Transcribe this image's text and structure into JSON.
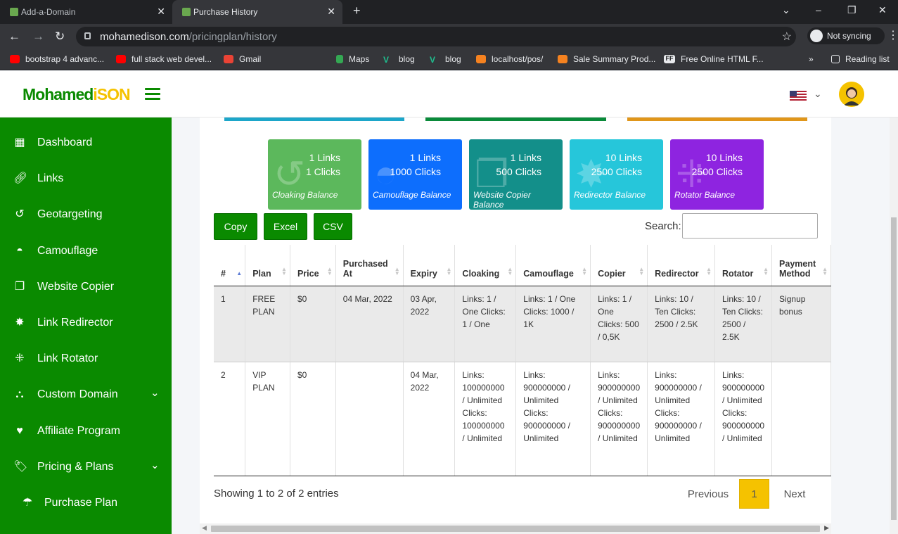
{
  "browser": {
    "tabs": [
      {
        "title": "Add-a-Domain",
        "close": "✕"
      },
      {
        "title": "Purchase History",
        "close": "✕"
      }
    ],
    "new_tab": "+",
    "url_host": "mohamedison.com",
    "url_path": "/pricingplan/history",
    "profile_label": "Not syncing",
    "bookmarks": [
      "bootstrap 4 advanc...",
      "full stack web devel...",
      "Gmail",
      "Maps",
      "blog",
      "blog",
      "localhost/pos/",
      "Sale Summary Prod...",
      "Free Online HTML F..."
    ],
    "bookmarks_more": "»",
    "reading_list": "Reading list"
  },
  "header": {
    "logo_part1": "Mohamed",
    "logo_part2": "iSON",
    "language_caret": "⌄"
  },
  "sidebar": {
    "items": [
      {
        "label": "Dashboard",
        "icon": "dashboard-icon"
      },
      {
        "label": "Links",
        "icon": "link-icon"
      },
      {
        "label": "Geotargeting",
        "icon": "history-icon"
      },
      {
        "label": "Camouflage",
        "icon": "hat-icon"
      },
      {
        "label": "Website Copier",
        "icon": "copy-icon"
      },
      {
        "label": "Link Redirector",
        "icon": "star-icon"
      },
      {
        "label": "Link Rotator",
        "icon": "rotator-icon"
      },
      {
        "label": "Custom Domain",
        "icon": "sitemap-icon",
        "caret": "⌄"
      },
      {
        "label": "Affiliate Program",
        "icon": "heart-icon"
      },
      {
        "label": "Pricing & Plans",
        "icon": "tags-icon",
        "caret": "⌄"
      },
      {
        "label": "Purchase Plan",
        "icon": "umbrella-icon"
      }
    ]
  },
  "tiles": [
    {
      "links": "1 Links",
      "clicks": "1 Clicks",
      "label": "Cloaking Balance",
      "color": "#5cb85c"
    },
    {
      "links": "1 Links",
      "clicks": "1000 Clicks",
      "label": "Camouflage Balance",
      "color": "#0d6efd"
    },
    {
      "links": "1 Links",
      "clicks": "500 Clicks",
      "label": "Website Copier Balance",
      "color": "#138f8a"
    },
    {
      "links": "10 Links",
      "clicks": "2500 Clicks",
      "label": "Redirector Balance",
      "color": "#26c6da"
    },
    {
      "links": "10 Links",
      "clicks": "2500 Clicks",
      "label": "Rotator Balance",
      "color": "#8e24e0"
    }
  ],
  "toolbar": {
    "copy": "Copy",
    "excel": "Excel",
    "csv": "CSV",
    "search_label": "Search:",
    "search_value": ""
  },
  "table": {
    "headers": [
      "#",
      "Plan",
      "Price",
      "Purchased At",
      "Expiry",
      "Cloaking",
      "Camouflage",
      "Copier",
      "Redirector",
      "Rotator",
      "Payment Method"
    ],
    "rows": [
      [
        "1",
        "FREE PLAN",
        "$0",
        "04 Mar, 2022",
        "03 Apr, 2022",
        "Links: 1 / One Clicks: 1 / One",
        "Links: 1 / One Clicks: 1000 / 1K",
        "Links: 1 / One Clicks: 500 / 0,5K",
        "Links: 10 / Ten Clicks: 2500 / 2.5K",
        "Links: 10 / Ten Clicks: 2500 / 2.5K",
        "Signup bonus"
      ],
      [
        "2",
        "VIP PLAN",
        "$0",
        "",
        "04 Mar, 2022",
        "Links: 100000000 / Unlimited Clicks: 100000000 / Unlimited",
        "Links: 900000000 / Unlimited Clicks: 900000000 / Unlimited",
        "Links: 900000000 / Unlimited Clicks: 900000000 / Unlimited",
        "Links: 900000000 / Unlimited Clicks: 900000000 / Unlimited",
        "Links: 900000000 / Unlimited Clicks: 900000000 / Unlimited",
        ""
      ]
    ]
  },
  "footer": {
    "entries": "Showing 1 to 2 of 2 entries",
    "previous": "Previous",
    "page": "1",
    "next": "Next"
  },
  "colors": {
    "brand_green": "#0a8a00",
    "brand_yellow": "#f5c200"
  }
}
